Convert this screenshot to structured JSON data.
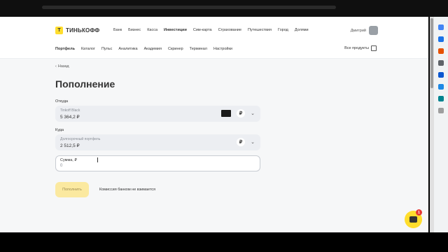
{
  "header": {
    "brand": "ТИНЬКОФФ",
    "brand_mark": "T",
    "nav": [
      "Банк",
      "Бизнес",
      "Касса",
      "Инвестиции",
      "Сим-карта",
      "Страхование",
      "Путешествия",
      "Город",
      "Долями"
    ],
    "nav_active": "Инвестиции",
    "user_name": "Дмитрий"
  },
  "subnav": {
    "items": [
      "Портфель",
      "Каталог",
      "Пульс",
      "Аналитика",
      "Академия",
      "Скринер",
      "Терминал",
      "Настройки"
    ],
    "active": "Портфель",
    "all_products": "Все продукты"
  },
  "page": {
    "back": "Назад",
    "title": "Пополнение",
    "from_label": "Откуда",
    "from_caption": "Tinkoff Black",
    "from_value": "5 364,2 ₽",
    "to_label": "Куда",
    "to_caption": "Долгосрочный портфель",
    "to_value": "2 512,5 ₽",
    "currency_symbol": "₽",
    "amount_caption": "Сумма, ₽",
    "amount_value": "0",
    "submit": "Пополнить",
    "commission": "Комиссия банком не взимается"
  },
  "chat": {
    "badge": "1"
  },
  "colors": {
    "accent": "#ffdd2d",
    "badge": "#e53935"
  }
}
